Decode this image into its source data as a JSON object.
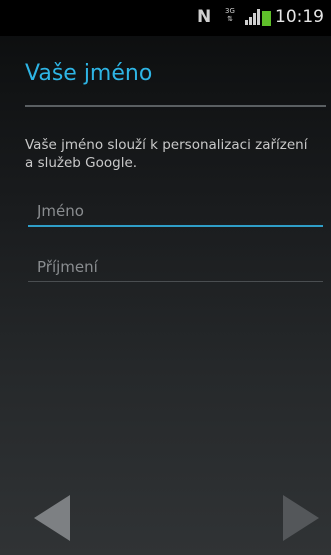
{
  "status_bar": {
    "notification_letter": "N",
    "network_type": "3G",
    "clock": "10:19",
    "battery_color": "#5fbf2a",
    "icons": [
      "nfc-icon",
      "3g-data-icon",
      "signal-bars-icon",
      "battery-icon"
    ]
  },
  "header": {
    "title": "Vaše jméno"
  },
  "main": {
    "description": "Vaše jméno slouží k personalizaci zařízení a služeb Google.",
    "first_name": {
      "placeholder": "Jméno",
      "value": ""
    },
    "last_name": {
      "placeholder": "Příjmení",
      "value": ""
    }
  },
  "navigation": {
    "back_icon": "back-arrow-icon",
    "next_icon": "next-arrow-icon"
  },
  "colors": {
    "accent": "#2eb5e5",
    "active_underline": "#2f9ec8"
  }
}
